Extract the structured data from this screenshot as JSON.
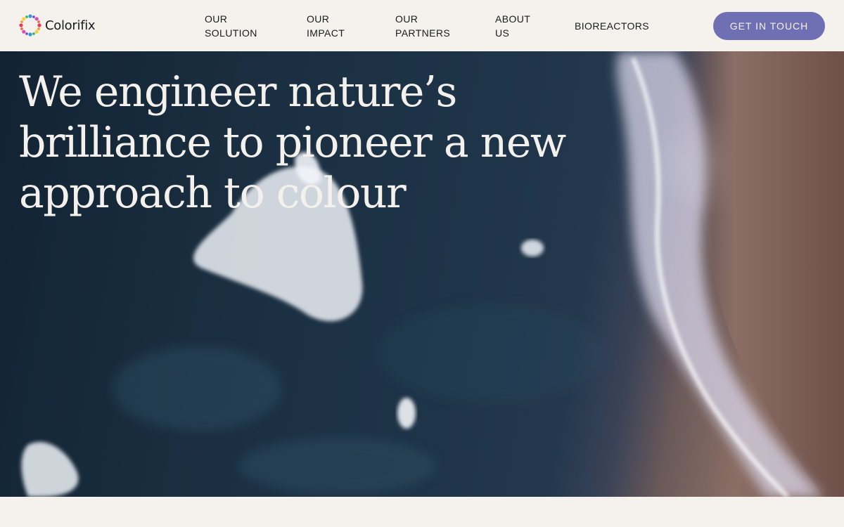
{
  "brand": {
    "name": "Colorifix",
    "logo_icon": "dotted-ring-logo-icon",
    "dot_colors": [
      "#e63a5c",
      "#f29a2e",
      "#f6d23c",
      "#3cb371",
      "#2e9bd6",
      "#7b4fd1",
      "#d94fb4",
      "#f06a3a"
    ]
  },
  "nav": {
    "items": [
      {
        "label": "OUR\nSOLUTION"
      },
      {
        "label": "OUR\nIMPACT"
      },
      {
        "label": "OUR\nPARTNERS"
      },
      {
        "label": "ABOUT\nUS"
      },
      {
        "label": "BIOREACTORS"
      }
    ],
    "cta_label": "GET IN TOUCH"
  },
  "hero": {
    "headline": "We engineer nature’s brilliance to pioneer a new approach to colour"
  },
  "colors": {
    "background": "#f5f1ec",
    "accent": "#6f70b3",
    "text": "#1b1b1b",
    "hero_text": "#f4f1ec"
  }
}
